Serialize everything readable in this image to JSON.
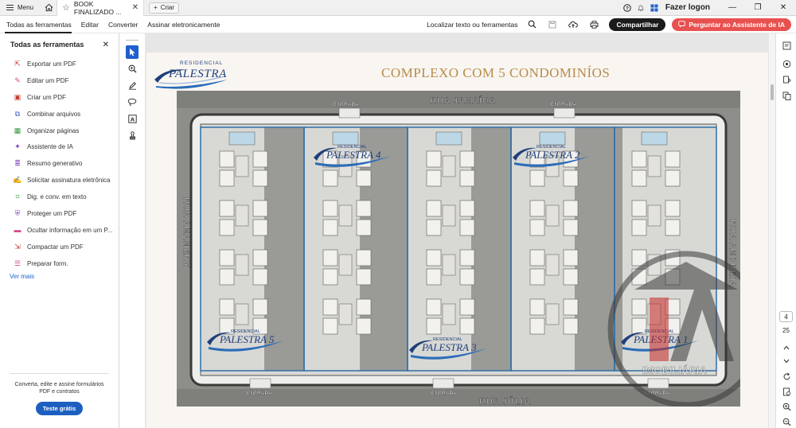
{
  "tabbar": {
    "menu_label": "Menu",
    "tab_title": "BOOK FINALIZADO ...",
    "new_label": "Criar",
    "login_label": "Fazer logon"
  },
  "toolbar": {
    "tabs": [
      "Todas as ferramentas",
      "Editar",
      "Converter",
      "Assinar eletronicamente"
    ],
    "search_label": "Localizar texto ou ferramentas",
    "share_label": "Compartilhar",
    "ai_label": "Perguntar ao Assistente de IA"
  },
  "left_panel": {
    "title": "Todas as ferramentas",
    "items": [
      {
        "label": "Exportar um PDF",
        "icon": "export-pdf-icon",
        "color": "#c0392b"
      },
      {
        "label": "Editar um PDF",
        "icon": "edit-pdf-icon",
        "color": "#d14a8b"
      },
      {
        "label": "Criar um PDF",
        "icon": "create-pdf-icon",
        "color": "#c0392b"
      },
      {
        "label": "Combinar arquivos",
        "icon": "combine-files-icon",
        "color": "#3a60c4"
      },
      {
        "label": "Organizar páginas",
        "icon": "organize-pages-icon",
        "color": "#2e9b3f"
      },
      {
        "label": "Assistente de IA",
        "icon": "ai-assistant-icon",
        "color": "#7a3fb8"
      },
      {
        "label": "Resumo generativo",
        "icon": "generative-summary-icon",
        "color": "#7a3fb8"
      },
      {
        "label": "Solicitar assinatura eletrônica",
        "icon": "request-signature-icon",
        "color": "#7a3fb8"
      },
      {
        "label": "Dig. e conv. em texto",
        "icon": "scan-ocr-icon",
        "color": "#2e9b3f"
      },
      {
        "label": "Proteger um PDF",
        "icon": "protect-pdf-icon",
        "color": "#7a3fb8"
      },
      {
        "label": "Ocultar informação em um P...",
        "icon": "redact-icon",
        "color": "#d14a8b"
      },
      {
        "label": "Compactar um PDF",
        "icon": "compress-pdf-icon",
        "color": "#c0392b"
      },
      {
        "label": "Preparar form.",
        "icon": "prepare-form-icon",
        "color": "#d14a8b"
      }
    ],
    "see_more": "Ver mais",
    "footer_text": "Converta, edite e assine formulários PDF e contratos",
    "trial_label": "Teste grátis"
  },
  "document": {
    "title": "COMPLEXO COM  5 CONDOMINÍOS",
    "logo_small": "RESIDENCIAL",
    "logo_name": "PALESTRA",
    "streets": {
      "top": "RUA JANAÍNA",
      "bottom": "RUA JÚLIA",
      "left": "RUA ANANERY",
      "right": "RUA ANDREIA"
    },
    "entrance_label": "ENTRADA",
    "condos": [
      "PALESTRA 4",
      "PALESTRA 2",
      "PALESTRA 5",
      "PALESTRA 3",
      "PALESTRA 1"
    ],
    "watermark": "IMOBILIÁRIA"
  },
  "page_indicator": {
    "current": "4",
    "total": "25"
  },
  "colors": {
    "accent": "#1f5fce",
    "ai": "#e8514f",
    "title_gold": "#b78b4a",
    "logo_blue": "#1f3f7a"
  }
}
